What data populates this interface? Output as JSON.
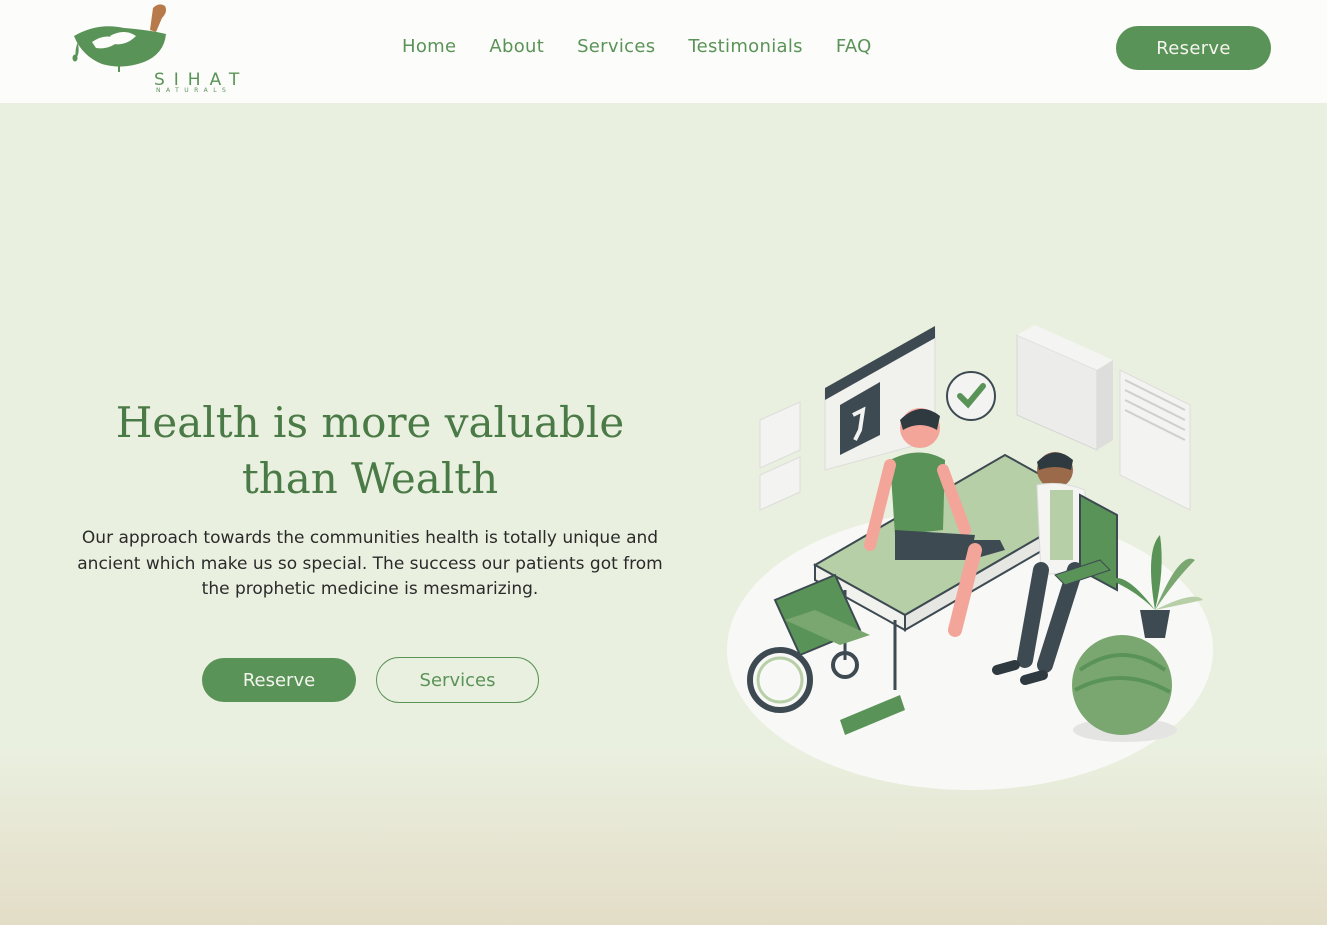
{
  "brand": {
    "name": "SIHAT",
    "tagline": "NATURALS",
    "accent_color": "#5a9357"
  },
  "nav": {
    "items": [
      {
        "label": "Home"
      },
      {
        "label": "About"
      },
      {
        "label": "Services"
      },
      {
        "label": "Testimonials"
      },
      {
        "label": "FAQ"
      }
    ],
    "cta_label": "Reserve"
  },
  "hero": {
    "headline": "Health is more valuable than Wealth",
    "description": "Our approach towards the communities health is totally unique and ancient which make us so special. The success our patients got from the prophetic medicine is mesmarizing.",
    "primary_button": "Reserve",
    "secondary_button": "Services",
    "illustration_icon": "doctor-patient-physiotherapy-illustration"
  }
}
